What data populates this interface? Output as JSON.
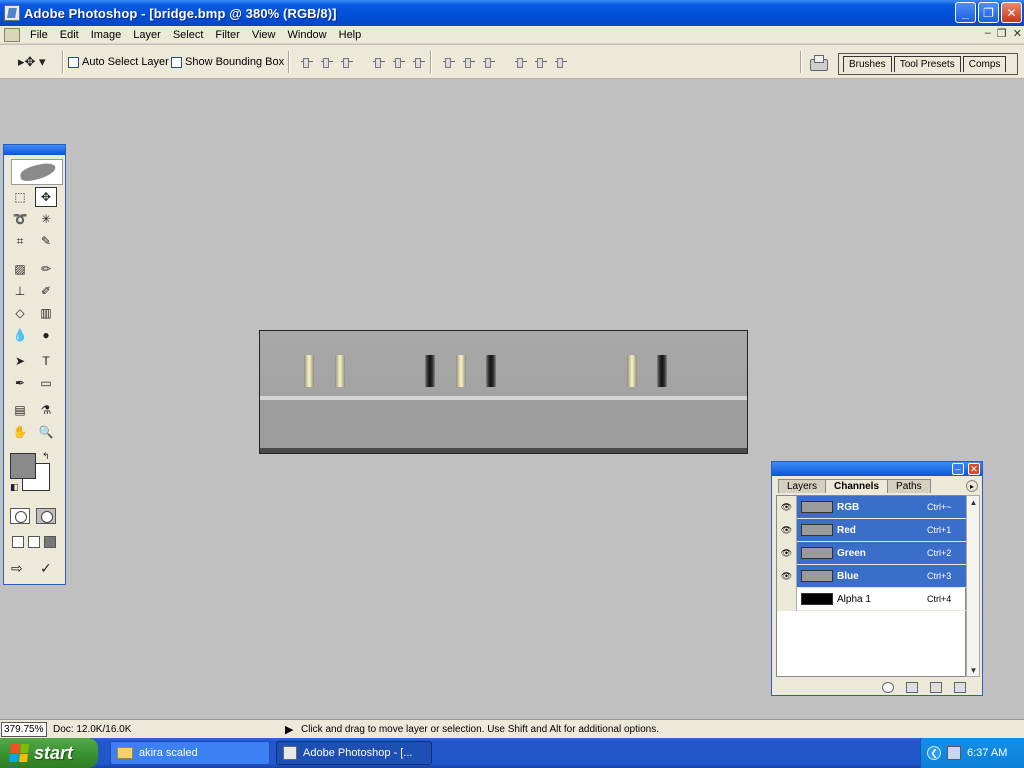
{
  "window": {
    "title": "Adobe Photoshop - [bridge.bmp @ 380% (RGB/8)]",
    "buttons": {
      "minimize": "_",
      "maximize": "❐",
      "close": "✕"
    }
  },
  "menu": {
    "items": [
      "File",
      "Edit",
      "Image",
      "Layer",
      "Select",
      "Filter",
      "View",
      "Window",
      "Help"
    ],
    "mdi": {
      "minimize": "–",
      "restore": "❐",
      "close": "✕"
    }
  },
  "options_bar": {
    "tool_glyph": "▸✥ ▾",
    "auto_select_label": "Auto Select Layer",
    "auto_select_checked": false,
    "show_bounding_box_label": "Show Bounding Box",
    "show_bounding_box_checked": false,
    "palette_well_tabs": [
      "Brushes",
      "Tool Presets",
      "Comps"
    ]
  },
  "toolbox": {
    "tools": [
      {
        "name": "rectangular-marquee-icon",
        "glyph": "⬚"
      },
      {
        "name": "move-icon",
        "glyph": "✥"
      },
      {
        "name": "lasso-icon",
        "glyph": "➰"
      },
      {
        "name": "magic-wand-icon",
        "glyph": "✳"
      },
      {
        "name": "crop-icon",
        "glyph": "⌗"
      },
      {
        "name": "slice-icon",
        "glyph": "✎"
      },
      {
        "name": "healing-brush-icon",
        "glyph": "▨"
      },
      {
        "name": "brush-icon",
        "glyph": "✏"
      },
      {
        "name": "clone-stamp-icon",
        "glyph": "⊥"
      },
      {
        "name": "history-brush-icon",
        "glyph": "✐"
      },
      {
        "name": "eraser-icon",
        "glyph": "◇"
      },
      {
        "name": "gradient-icon",
        "glyph": "▥"
      },
      {
        "name": "blur-icon",
        "glyph": "💧"
      },
      {
        "name": "dodge-icon",
        "glyph": "●"
      },
      {
        "name": "path-selection-icon",
        "glyph": "➤"
      },
      {
        "name": "type-icon",
        "glyph": "T"
      },
      {
        "name": "pen-icon",
        "glyph": "✒"
      },
      {
        "name": "shape-icon",
        "glyph": "▭"
      },
      {
        "name": "notes-icon",
        "glyph": "▤"
      },
      {
        "name": "eyedropper-icon",
        "glyph": "⚗"
      },
      {
        "name": "hand-icon",
        "glyph": "✋"
      },
      {
        "name": "zoom-icon",
        "glyph": "🔍"
      }
    ],
    "foreground_color": "#8a8a8a",
    "background_color": "#ffffff",
    "swap_glyph": "↰",
    "default_glyph": "◧",
    "jump_glyph": "⇨",
    "check_glyph": "✓"
  },
  "channels_panel": {
    "tabs": [
      "Layers",
      "Channels",
      "Paths"
    ],
    "active_tab": "Channels",
    "menu_glyph": "▸",
    "eye_glyph": "👁",
    "rows": [
      {
        "name": "RGB",
        "shortcut": "Ctrl+~",
        "selected": true,
        "visible": true
      },
      {
        "name": "Red",
        "shortcut": "Ctrl+1",
        "selected": true,
        "visible": true
      },
      {
        "name": "Green",
        "shortcut": "Ctrl+2",
        "selected": true,
        "visible": true
      },
      {
        "name": "Blue",
        "shortcut": "Ctrl+3",
        "selected": true,
        "visible": true
      },
      {
        "name": "Alpha 1",
        "shortcut": "Ctrl+4",
        "selected": false,
        "visible": false
      }
    ],
    "scroll_up": "▲",
    "scroll_down": "▼"
  },
  "status": {
    "zoom": "379.75%",
    "doc": "Doc: 12.0K/16.0K",
    "arrow": "▶",
    "hint": "Click and drag to move layer or selection.  Use Shift and Alt for additional options."
  },
  "taskbar": {
    "start_label": "start",
    "buttons": [
      {
        "label": "akira scaled",
        "active": false
      },
      {
        "label": "Adobe Photoshop - [...",
        "active": true
      }
    ],
    "tray_chevron": "❮",
    "clock": "6:37 AM"
  },
  "colors": {
    "title_bar": "#0050d8",
    "workspace": "#c0c0c0",
    "selection": "#3a6ec9",
    "start_green": "#3a9431"
  }
}
